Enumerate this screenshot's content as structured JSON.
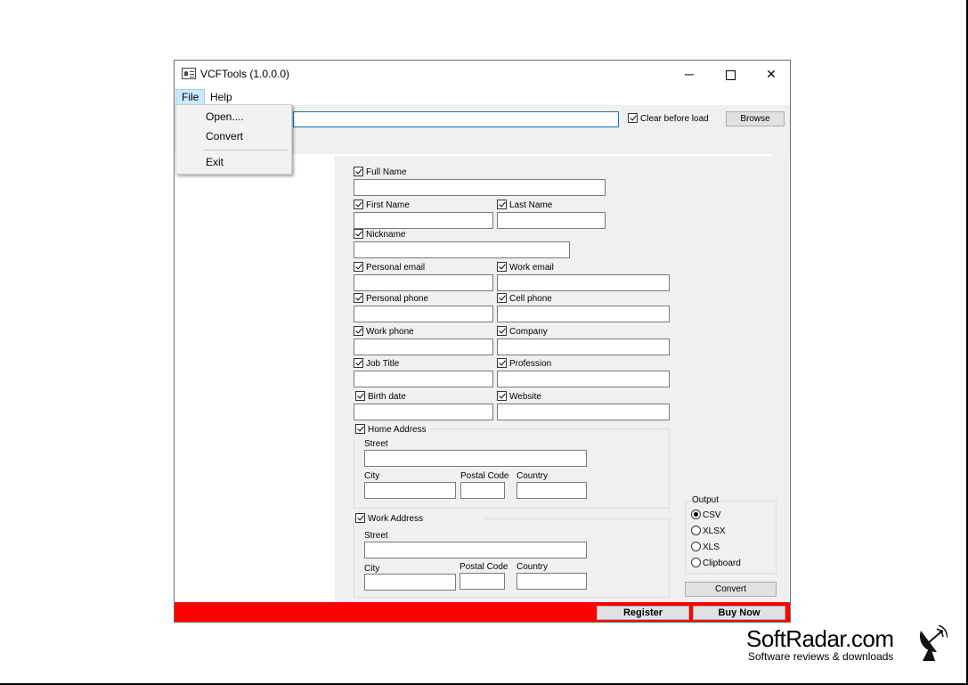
{
  "window": {
    "title": "VCFTools (1.0.0.0)",
    "controls": {
      "minimize": "─",
      "close": "✕"
    }
  },
  "menu": {
    "file": "File",
    "help": "Help",
    "file_items": [
      "Open....",
      "Convert",
      "Exit"
    ]
  },
  "toolbar": {
    "path_value": "",
    "clear_before_load": "Clear before load",
    "clear_checked": true,
    "browse": "Browse"
  },
  "fields": {
    "full_name": "Full Name",
    "first_name": "First Name",
    "last_name": "Last Name",
    "nickname": "Nickname",
    "personal_email": "Personal email",
    "work_email": "Work email",
    "personal_phone": "Personal phone",
    "cell_phone": "Cell phone",
    "work_phone": "Work phone",
    "company": "Company",
    "job_title": "Job Title",
    "profession": "Profession",
    "birth_date": "Birth date",
    "website": "Website"
  },
  "home_address": {
    "title": "Home Address",
    "street": "Street",
    "city": "City",
    "postal_code": "Postal Code",
    "country": "Country"
  },
  "work_address": {
    "title": "Work Address",
    "street": "Street",
    "city": "City",
    "postal_code": "Postal Code",
    "country": "Country"
  },
  "output": {
    "legend": "Output",
    "options": [
      "CSV",
      "XLSX",
      "XLS",
      "Clipboard"
    ],
    "selected": "CSV",
    "convert": "Convert"
  },
  "bottom": {
    "register": "Register",
    "buy_now": "Buy Now",
    "bar_color": "#ff0000"
  },
  "watermark": {
    "brand": "SoftRadar.com",
    "tagline": "Software reviews & downloads"
  }
}
